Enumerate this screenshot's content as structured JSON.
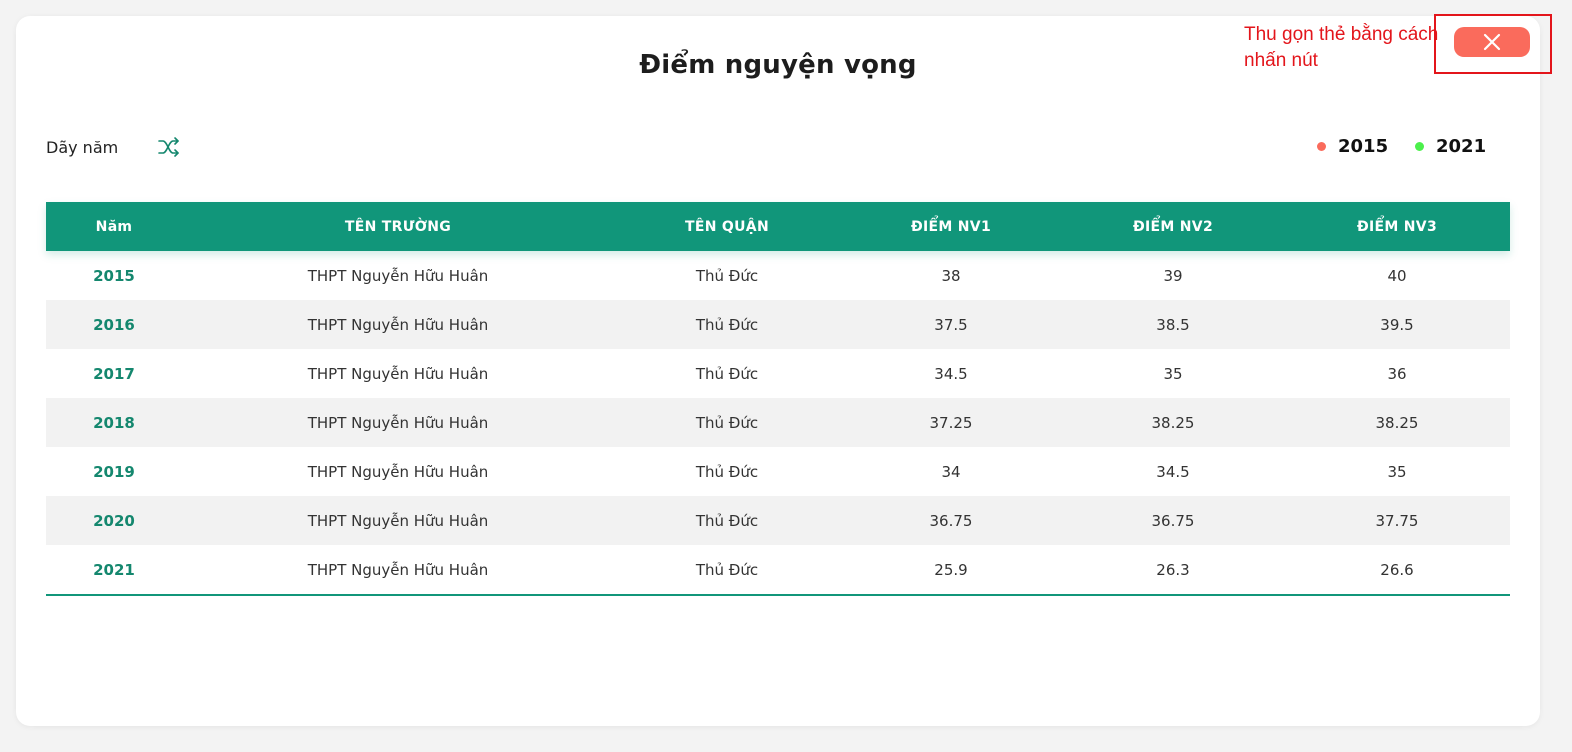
{
  "title": "Điểm nguyện vọng",
  "hint": {
    "text": "Thu gọn thẻ bằng cách nhấn nút",
    "color": "#e3151b"
  },
  "close_button": {
    "icon": "close-icon",
    "color": "#fa6b5c"
  },
  "sort": {
    "label": "Dãy năm",
    "icon": "shuffle-icon"
  },
  "legend": [
    {
      "label": "2015",
      "color": "#fa6b5c"
    },
    {
      "label": "2021",
      "color": "#4cf04c"
    }
  ],
  "table": {
    "accent": "#11967a",
    "headers": [
      "Năm",
      "TÊN TRƯỜNG",
      "TÊN QUẬN",
      "ĐIỂM NV1",
      "ĐIỂM NV2",
      "ĐIỂM NV3"
    ],
    "rows": [
      [
        "2015",
        "THPT Nguyễn Hữu Huân",
        "Thủ Đức",
        "38",
        "39",
        "40"
      ],
      [
        "2016",
        "THPT Nguyễn Hữu Huân",
        "Thủ Đức",
        "37.5",
        "38.5",
        "39.5"
      ],
      [
        "2017",
        "THPT Nguyễn Hữu Huân",
        "Thủ Đức",
        "34.5",
        "35",
        "36"
      ],
      [
        "2018",
        "THPT Nguyễn Hữu Huân",
        "Thủ Đức",
        "37.25",
        "38.25",
        "38.25"
      ],
      [
        "2019",
        "THPT Nguyễn Hữu Huân",
        "Thủ Đức",
        "34",
        "34.5",
        "35"
      ],
      [
        "2020",
        "THPT Nguyễn Hữu Huân",
        "Thủ Đức",
        "36.75",
        "36.75",
        "37.75"
      ],
      [
        "2021",
        "THPT Nguyễn Hữu Huân",
        "Thủ Đức",
        "25.9",
        "26.3",
        "26.6"
      ]
    ]
  }
}
